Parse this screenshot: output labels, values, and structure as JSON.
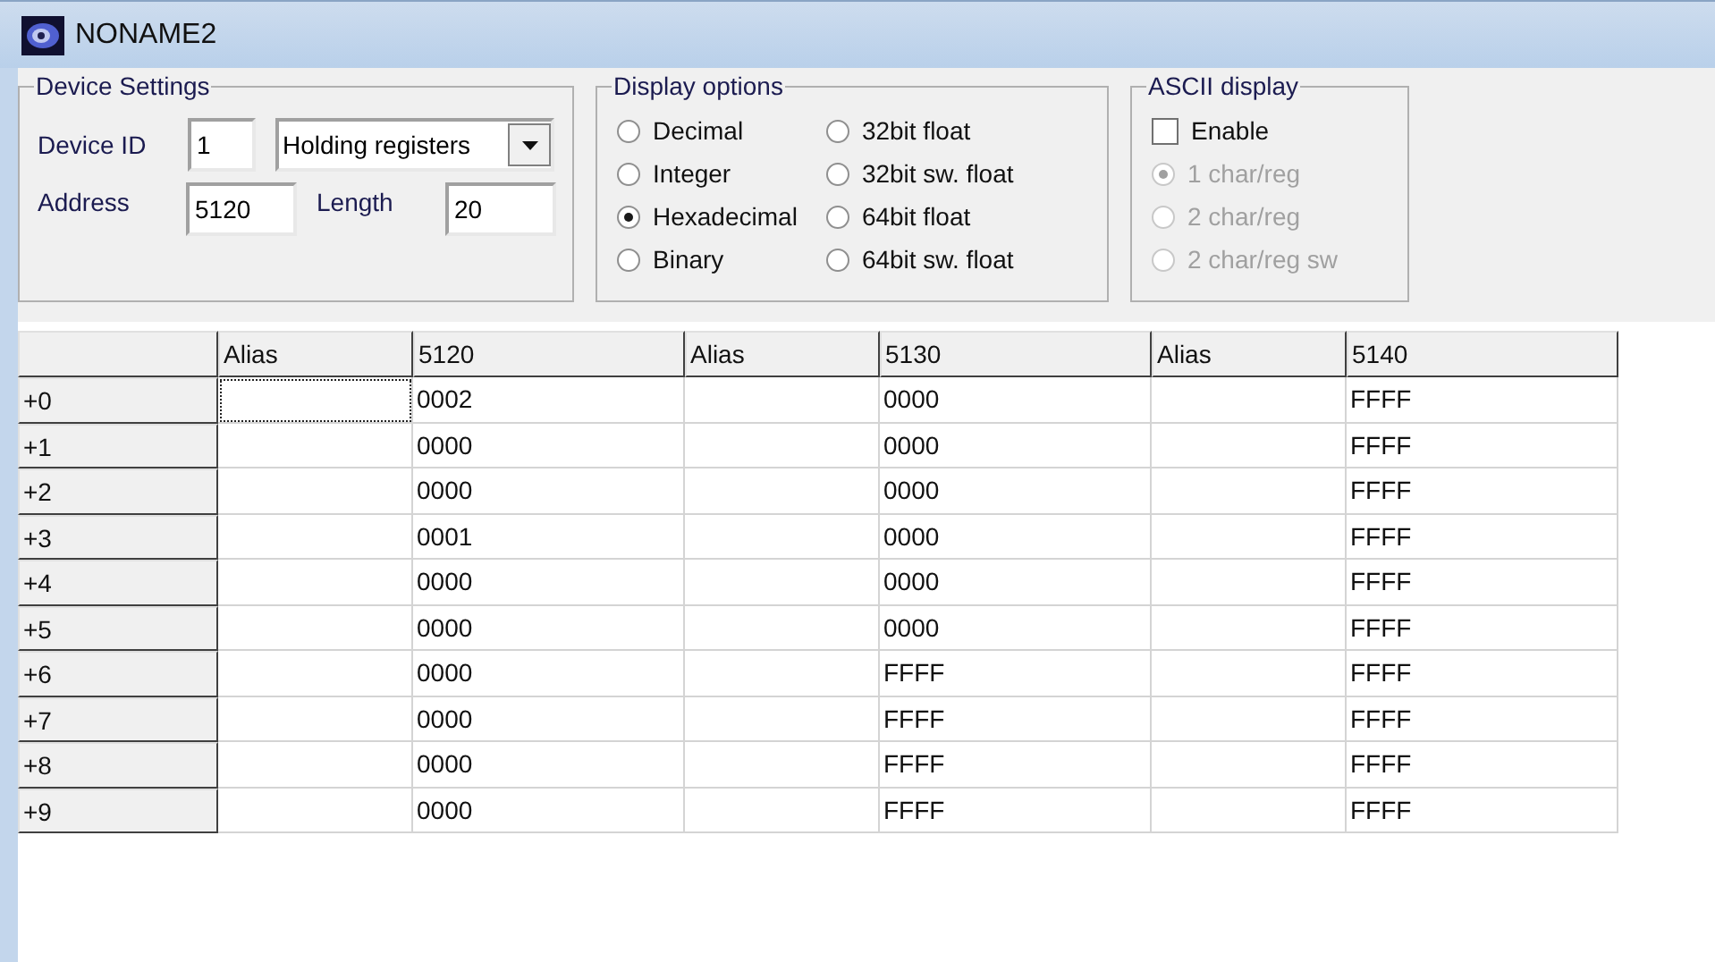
{
  "window": {
    "title": "NONAME2"
  },
  "device_settings": {
    "title": "Device Settings",
    "device_id_label": "Device ID",
    "device_id": "1",
    "register_type": "Holding registers",
    "address_label": "Address",
    "address": "5120",
    "length_label": "Length",
    "length": "20"
  },
  "display_options": {
    "title": "Display options",
    "options": [
      {
        "label": "Decimal",
        "selected": false
      },
      {
        "label": "Integer",
        "selected": false
      },
      {
        "label": "Hexadecimal",
        "selected": true
      },
      {
        "label": "Binary",
        "selected": false
      },
      {
        "label": "32bit float",
        "selected": false
      },
      {
        "label": "32bit sw. float",
        "selected": false
      },
      {
        "label": "64bit float",
        "selected": false
      },
      {
        "label": "64bit sw. float",
        "selected": false
      }
    ]
  },
  "ascii_display": {
    "title": "ASCII display",
    "enable": {
      "label": "Enable",
      "checked": false
    },
    "modes": [
      {
        "label": "1 char/reg",
        "selected": true,
        "disabled": true
      },
      {
        "label": "2 char/reg",
        "selected": false,
        "disabled": true
      },
      {
        "label": "2 char/reg sw",
        "selected": false,
        "disabled": true
      }
    ]
  },
  "grid": {
    "columns": [
      {
        "kind": "alias",
        "label": "Alias"
      },
      {
        "kind": "value",
        "label": "5120"
      },
      {
        "kind": "alias",
        "label": "Alias"
      },
      {
        "kind": "value",
        "label": "5130"
      },
      {
        "kind": "alias",
        "label": "Alias"
      },
      {
        "kind": "value",
        "label": "5140"
      }
    ],
    "rows": [
      {
        "label": "+0",
        "cells": [
          {
            "selected": true
          },
          {
            "text": "0002",
            "selected": false
          },
          {
            "selected": false
          },
          {
            "text": "0000",
            "selected": false
          },
          {
            "selected": false
          },
          {
            "text": "FFFF",
            "selected": false
          }
        ]
      },
      {
        "label": "+1",
        "cells": [
          {
            "selected": false
          },
          {
            "text": "0000",
            "selected": false
          },
          {
            "selected": false
          },
          {
            "text": "0000",
            "selected": false
          },
          {
            "selected": false
          },
          {
            "text": "FFFF",
            "selected": false
          }
        ]
      },
      {
        "label": "+2",
        "cells": [
          {
            "selected": false
          },
          {
            "text": "0000",
            "selected": false
          },
          {
            "selected": false
          },
          {
            "text": "0000",
            "selected": false
          },
          {
            "selected": false
          },
          {
            "text": "FFFF",
            "selected": false
          }
        ]
      },
      {
        "label": "+3",
        "cells": [
          {
            "selected": false
          },
          {
            "text": "0001",
            "selected": false
          },
          {
            "selected": false
          },
          {
            "text": "0000",
            "selected": false
          },
          {
            "selected": false
          },
          {
            "text": "FFFF",
            "selected": false
          }
        ]
      },
      {
        "label": "+4",
        "cells": [
          {
            "selected": false
          },
          {
            "text": "0000",
            "selected": false
          },
          {
            "selected": false
          },
          {
            "text": "0000",
            "selected": false
          },
          {
            "selected": false
          },
          {
            "text": "FFFF",
            "selected": false
          }
        ]
      },
      {
        "label": "+5",
        "cells": [
          {
            "selected": false
          },
          {
            "text": "0000",
            "selected": false
          },
          {
            "selected": false
          },
          {
            "text": "0000",
            "selected": false
          },
          {
            "selected": false
          },
          {
            "text": "FFFF",
            "selected": false
          }
        ]
      },
      {
        "label": "+6",
        "cells": [
          {
            "selected": false
          },
          {
            "text": "0000",
            "selected": false
          },
          {
            "selected": false
          },
          {
            "text": "FFFF",
            "selected": false
          },
          {
            "selected": false
          },
          {
            "text": "FFFF",
            "selected": false
          }
        ]
      },
      {
        "label": "+7",
        "cells": [
          {
            "selected": false
          },
          {
            "text": "0000",
            "selected": false
          },
          {
            "selected": false
          },
          {
            "text": "FFFF",
            "selected": false
          },
          {
            "selected": false
          },
          {
            "text": "FFFF",
            "selected": false
          }
        ]
      },
      {
        "label": "+8",
        "cells": [
          {
            "selected": false
          },
          {
            "text": "0000",
            "selected": false
          },
          {
            "selected": false
          },
          {
            "text": "FFFF",
            "selected": false
          },
          {
            "selected": false
          },
          {
            "text": "FFFF",
            "selected": false
          }
        ]
      },
      {
        "label": "+9",
        "cells": [
          {
            "selected": false
          },
          {
            "text": "0000",
            "selected": false
          },
          {
            "selected": false
          },
          {
            "text": "FFFF",
            "selected": false
          },
          {
            "selected": false
          },
          {
            "text": "FFFF",
            "selected": false
          }
        ]
      }
    ]
  }
}
